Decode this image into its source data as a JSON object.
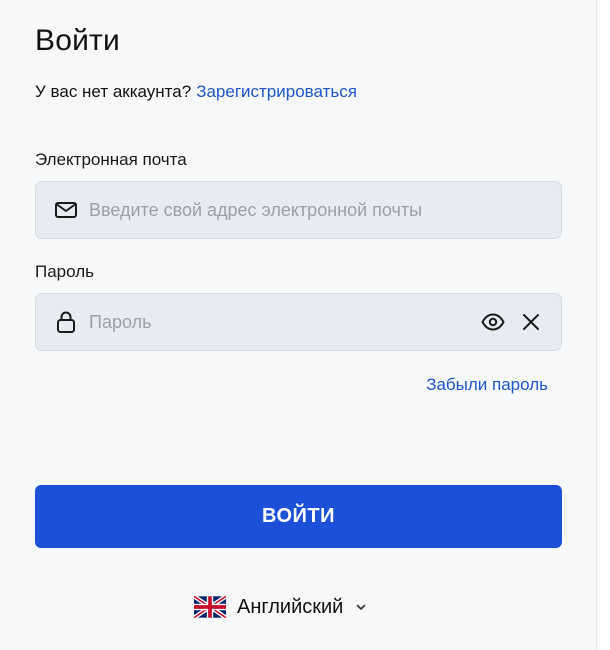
{
  "form": {
    "title": "Войти",
    "signup_prompt": "У вас нет аккаунта?",
    "signup_link": "Зарегистрироваться",
    "email": {
      "label": "Электронная почта",
      "placeholder": "Введите свой адрес электронной почты",
      "value": "",
      "icon": "mail-icon"
    },
    "password": {
      "label": "Пароль",
      "placeholder": "Пароль",
      "value": "",
      "icon": "lock-icon",
      "show_icon": "eye-icon",
      "clear_icon": "close-icon"
    },
    "forgot_link": "Забыли пароль",
    "submit_label": "ВОЙТИ"
  },
  "language": {
    "selected": "Английский",
    "flag_icon": "uk-flag-icon",
    "chevron_icon": "chevron-down-icon"
  },
  "colors": {
    "accent": "#1c50d8",
    "link": "#1f56c9",
    "field_bg": "#e8ecf2",
    "panel_bg": "#f7f8fa"
  }
}
